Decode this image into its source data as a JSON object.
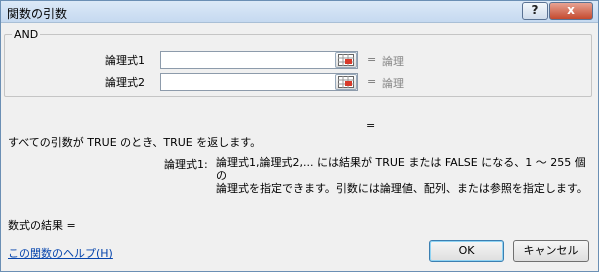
{
  "window": {
    "title": "関数の引数",
    "help_glyph": "?",
    "close_glyph": "x"
  },
  "function_group": {
    "name": "AND",
    "args": [
      {
        "label": "論理式1",
        "value": "",
        "eq": "=",
        "result": "論理"
      },
      {
        "label": "論理式2",
        "value": "",
        "eq": "=",
        "result": "論理"
      }
    ]
  },
  "formula_result_eq": "=",
  "description": "すべての引数が TRUE のとき、TRUE を返します。",
  "param_help": {
    "name": "論理式1:",
    "text_line1": "論理式1,論理式2,... には結果が TRUE または FALSE になる、1 ～ 255 個の",
    "text_line2": "論理式を指定できます。引数には論理値、配列、または参照を指定します。"
  },
  "result_label": "数式の結果 =",
  "help_link": "この関数のヘルプ(H)",
  "buttons": {
    "ok": "OK",
    "cancel": "キャンセル"
  },
  "icons": {
    "ref_icon": "range-select-icon"
  }
}
